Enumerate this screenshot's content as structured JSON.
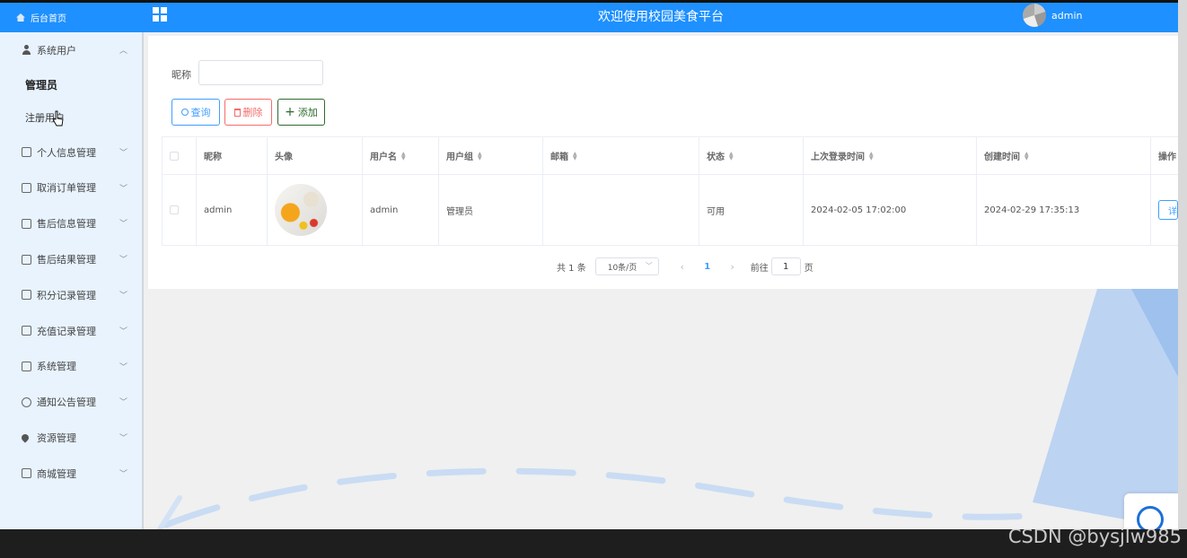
{
  "header": {
    "home_label": "后台首页",
    "title": "欢迎使用校园美食平台",
    "username": "admin"
  },
  "sidebar": {
    "group_system_user": "系统用户",
    "sub_items": [
      "管理员",
      "注册用户"
    ],
    "items": [
      {
        "label": "个人信息管理",
        "icon": "document-icon"
      },
      {
        "label": "取消订单管理",
        "icon": "document-icon"
      },
      {
        "label": "售后信息管理",
        "icon": "document-icon"
      },
      {
        "label": "售后结果管理",
        "icon": "document-icon"
      },
      {
        "label": "积分记录管理",
        "icon": "document-icon"
      },
      {
        "label": "充值记录管理",
        "icon": "document-icon"
      },
      {
        "label": "系统管理",
        "icon": "image-icon"
      },
      {
        "label": "通知公告管理",
        "icon": "info-icon"
      },
      {
        "label": "资源管理",
        "icon": "pin-icon"
      },
      {
        "label": "商城管理",
        "icon": "cart-icon"
      }
    ]
  },
  "search": {
    "label": "昵称",
    "value": "",
    "placeholder": ""
  },
  "toolbar": {
    "query_label": "查询",
    "delete_label": "删除",
    "add_label": "添加"
  },
  "table": {
    "columns": [
      "昵称",
      "头像",
      "用户名",
      "用户组",
      "邮箱",
      "状态",
      "上次登录时间",
      "创建时间",
      "操作"
    ],
    "rows": [
      {
        "nickname": "admin",
        "username": "admin",
        "group": "管理员",
        "email": "",
        "status": "可用",
        "last_login": "2024-02-05 17:02:00",
        "created": "2024-02-29 17:35:13",
        "action": "详"
      }
    ]
  },
  "pagination": {
    "total": "共 1 条",
    "page_size": "10条/页",
    "current_page": "1",
    "goto_label": "前往",
    "goto_value": "1",
    "page_suffix": "页"
  },
  "watermark": "CSDN @bysjlw985"
}
